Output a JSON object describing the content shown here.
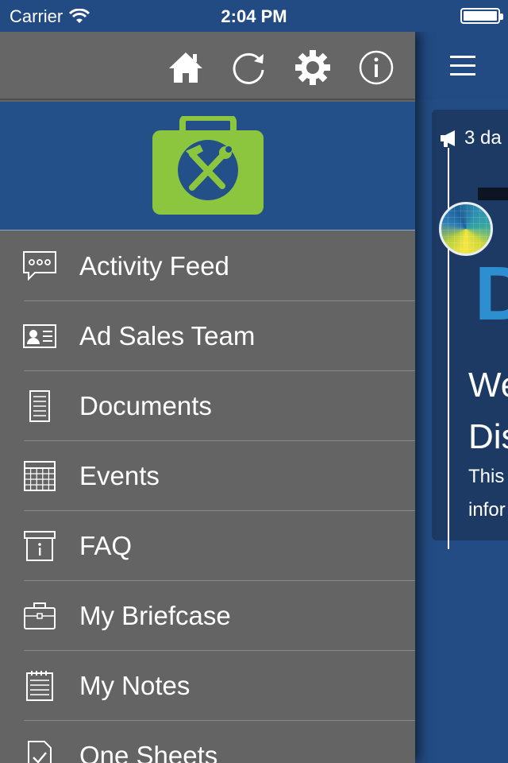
{
  "status_bar": {
    "carrier": "Carrier",
    "time": "2:04 PM"
  },
  "toolbar": {
    "icons": [
      "home-icon",
      "refresh-icon",
      "gear-icon",
      "info-icon"
    ]
  },
  "colors": {
    "accent_blue": "#24508a",
    "drawer_gray": "#646464",
    "toolbox_green": "#8cc63f"
  },
  "menu": {
    "items": [
      {
        "label": "Activity Feed",
        "icon": "chat-bubble-icon"
      },
      {
        "label": "Ad Sales Team",
        "icon": "contact-card-icon"
      },
      {
        "label": "Documents",
        "icon": "document-icon"
      },
      {
        "label": "Events",
        "icon": "calendar-icon"
      },
      {
        "label": "FAQ",
        "icon": "info-box-icon"
      },
      {
        "label": "My Briefcase",
        "icon": "briefcase-icon"
      },
      {
        "label": "My Notes",
        "icon": "notepad-icon"
      },
      {
        "label": "One Sheets",
        "icon": "checked-document-icon"
      }
    ]
  },
  "feed": {
    "time_ago": "3 da",
    "heading_line1": "We",
    "heading_line2": "Dis",
    "body_line1": "This",
    "body_line2": "infor"
  }
}
